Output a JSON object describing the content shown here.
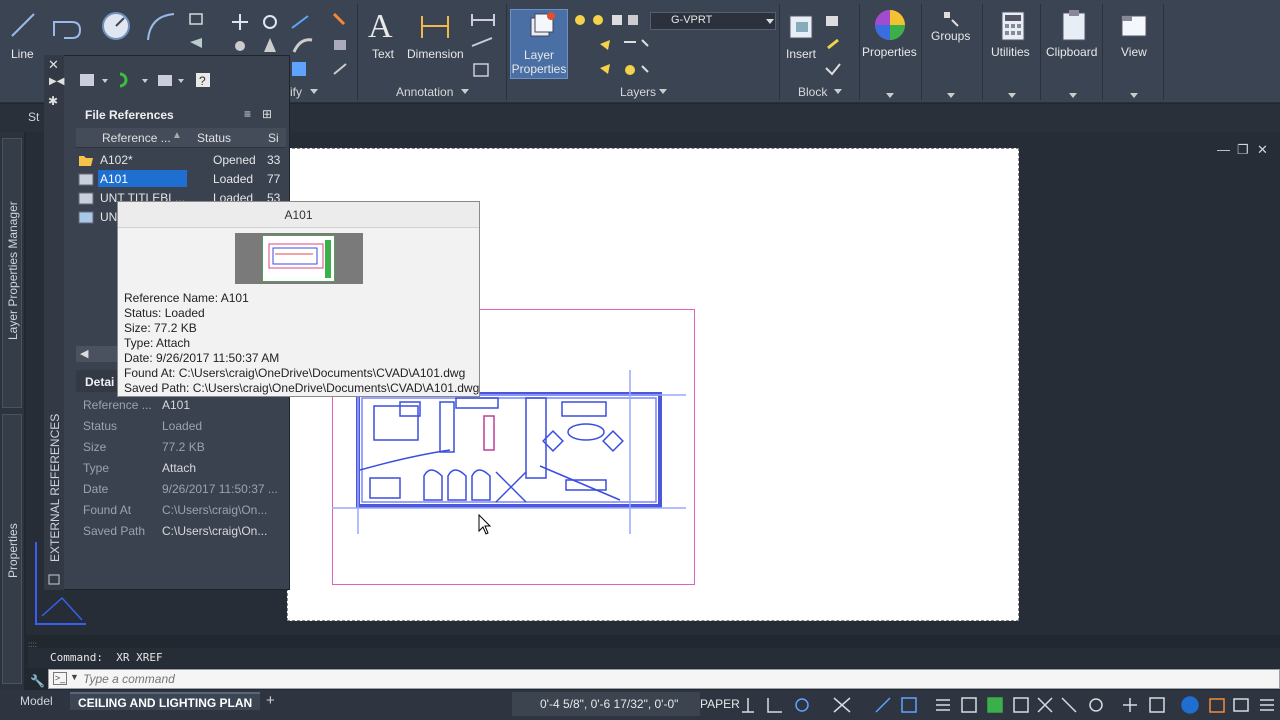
{
  "ribbon": {
    "draw_buttons": [
      "Line",
      "Polyline",
      "Circle",
      "Arc"
    ],
    "modify_label_partial": "ify",
    "annotation": {
      "text": "Text",
      "dimension": "Dimension",
      "panel": "Annotation"
    },
    "layers": {
      "button": "Layer\nProperties",
      "current_layer": "G-VPRT",
      "panel": "Layers",
      "layer_color": "#ff3fa8"
    },
    "block": {
      "insert": "Insert",
      "panel": "Block"
    },
    "properties": "Properties",
    "groups": "Groups",
    "utilities": "Utilities",
    "clipboard": "Clipboard",
    "view": "View",
    "start_tab_partial": "St"
  },
  "xref": {
    "palette_title": "EXTERNAL REFERENCES",
    "file_references": "File References",
    "columns": {
      "name": "Reference ...",
      "status": "Status",
      "size": "Si"
    },
    "rows": [
      {
        "name": "A102*",
        "status": "Opened",
        "size": "33"
      },
      {
        "name": "A101",
        "status": "Loaded",
        "size": "77"
      },
      {
        "name": "UNT TITLEBL...",
        "status": "Loaded",
        "size": "53"
      },
      {
        "name": "UN",
        "status": "",
        "size": ""
      }
    ],
    "details_title": "Detai",
    "details": [
      {
        "label": "Reference ...",
        "value": "A101",
        "dim": false
      },
      {
        "label": "Status",
        "value": "Loaded",
        "dim": true
      },
      {
        "label": "Size",
        "value": "77.2 KB",
        "dim": true
      },
      {
        "label": "Type",
        "value": "Attach",
        "dim": false
      },
      {
        "label": "Date",
        "value": "9/26/2017 11:50:37 ...",
        "dim": true
      },
      {
        "label": "Found At",
        "value": "C:\\Users\\craig\\On...",
        "dim": true
      },
      {
        "label": "Saved Path",
        "value": "C:\\Users\\craig\\On...",
        "dim": false
      }
    ]
  },
  "tooltip": {
    "title": "A101",
    "lines": [
      "Reference Name: A101",
      "Status: Loaded",
      "Size: 77.2 KB",
      "Type: Attach",
      "Date: 9/26/2017 11:50:37 AM",
      "Found At: C:\\Users\\craig\\OneDrive\\Documents\\CVAD\\A101.dwg",
      "Saved Path: C:\\Users\\craig\\OneDrive\\Documents\\CVAD\\A101.dwg"
    ]
  },
  "side_palettes": {
    "layer_manager": "Layer Properties Manager",
    "properties": "Properties"
  },
  "command": {
    "history": "Command:  XR XREF",
    "placeholder": "Type a command"
  },
  "status": {
    "model_tab": "Model",
    "layout_tab": "CEILING AND LIGHTING PLAN",
    "coords": "0'-4 5/8\", 0'-6 17/32\", 0'-0\"",
    "space": "PAPER"
  },
  "colors": {
    "accent": "#1f6fd1",
    "viewport": "#e060c0",
    "plan_lines": "#3a4ee0"
  }
}
